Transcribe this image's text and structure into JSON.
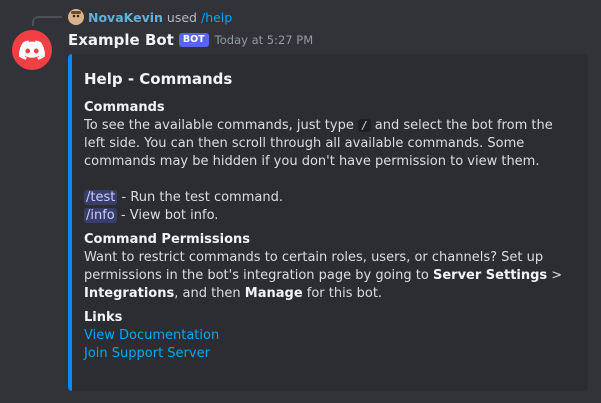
{
  "reply": {
    "user": "NovaKevin",
    "used_text": "used",
    "command": "/help"
  },
  "author": {
    "name": "Example Bot",
    "tag": "BOT",
    "timestamp": "Today at 5:27 PM"
  },
  "embed": {
    "accent_color": "#0d86f7",
    "title": "Help - Commands",
    "commands_field": {
      "name": "Commands",
      "line1_a": "To see the available commands, just type",
      "slash": "/",
      "line1_b": "and select the bot from the left side.",
      "line2": "You can then scroll through all available commands. Some commands may be hidden if you don't have permission to view them.",
      "cmd1": "/test",
      "cmd1_desc": " - Run the test command.",
      "cmd2": "/info",
      "cmd2_desc": " - View bot info."
    },
    "permissions_field": {
      "name": "Command Permissions",
      "text_a": "Want to restrict commands to certain roles, users, or channels? Set up permissions in the bot's integration page by going to ",
      "bold1": "Server Settings",
      "sep": " > ",
      "bold2": "Integrations",
      "text_b": ", and then ",
      "bold3": "Manage",
      "text_c": " for this bot."
    },
    "links_field": {
      "name": "Links",
      "link1": "View Documentation",
      "link2": "Join Support Server"
    }
  }
}
